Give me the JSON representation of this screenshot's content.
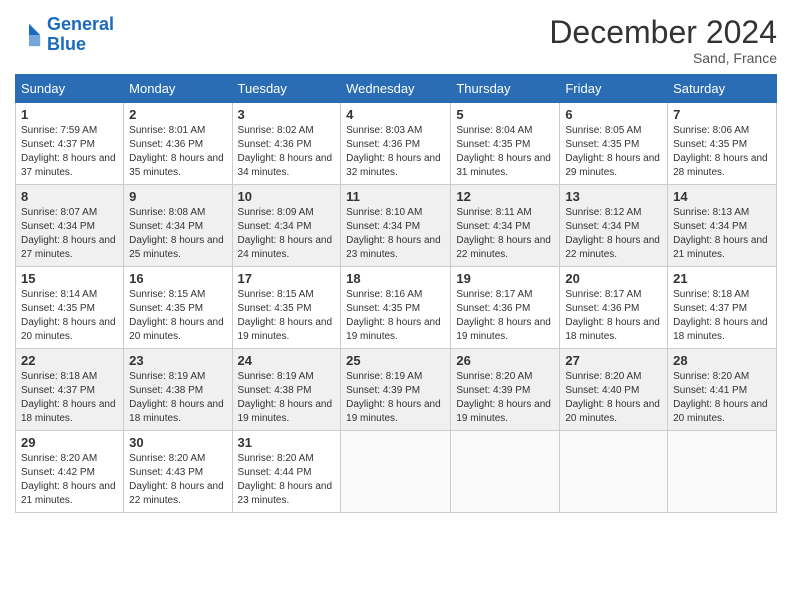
{
  "header": {
    "logo_line1": "General",
    "logo_line2": "Blue",
    "month_title": "December 2024",
    "location": "Sand, France"
  },
  "days_of_week": [
    "Sunday",
    "Monday",
    "Tuesday",
    "Wednesday",
    "Thursday",
    "Friday",
    "Saturday"
  ],
  "weeks": [
    [
      {
        "day": "1",
        "sunrise": "Sunrise: 7:59 AM",
        "sunset": "Sunset: 4:37 PM",
        "daylight": "Daylight: 8 hours and 37 minutes."
      },
      {
        "day": "2",
        "sunrise": "Sunrise: 8:01 AM",
        "sunset": "Sunset: 4:36 PM",
        "daylight": "Daylight: 8 hours and 35 minutes."
      },
      {
        "day": "3",
        "sunrise": "Sunrise: 8:02 AM",
        "sunset": "Sunset: 4:36 PM",
        "daylight": "Daylight: 8 hours and 34 minutes."
      },
      {
        "day": "4",
        "sunrise": "Sunrise: 8:03 AM",
        "sunset": "Sunset: 4:36 PM",
        "daylight": "Daylight: 8 hours and 32 minutes."
      },
      {
        "day": "5",
        "sunrise": "Sunrise: 8:04 AM",
        "sunset": "Sunset: 4:35 PM",
        "daylight": "Daylight: 8 hours and 31 minutes."
      },
      {
        "day": "6",
        "sunrise": "Sunrise: 8:05 AM",
        "sunset": "Sunset: 4:35 PM",
        "daylight": "Daylight: 8 hours and 29 minutes."
      },
      {
        "day": "7",
        "sunrise": "Sunrise: 8:06 AM",
        "sunset": "Sunset: 4:35 PM",
        "daylight": "Daylight: 8 hours and 28 minutes."
      }
    ],
    [
      {
        "day": "8",
        "sunrise": "Sunrise: 8:07 AM",
        "sunset": "Sunset: 4:34 PM",
        "daylight": "Daylight: 8 hours and 27 minutes."
      },
      {
        "day": "9",
        "sunrise": "Sunrise: 8:08 AM",
        "sunset": "Sunset: 4:34 PM",
        "daylight": "Daylight: 8 hours and 25 minutes."
      },
      {
        "day": "10",
        "sunrise": "Sunrise: 8:09 AM",
        "sunset": "Sunset: 4:34 PM",
        "daylight": "Daylight: 8 hours and 24 minutes."
      },
      {
        "day": "11",
        "sunrise": "Sunrise: 8:10 AM",
        "sunset": "Sunset: 4:34 PM",
        "daylight": "Daylight: 8 hours and 23 minutes."
      },
      {
        "day": "12",
        "sunrise": "Sunrise: 8:11 AM",
        "sunset": "Sunset: 4:34 PM",
        "daylight": "Daylight: 8 hours and 22 minutes."
      },
      {
        "day": "13",
        "sunrise": "Sunrise: 8:12 AM",
        "sunset": "Sunset: 4:34 PM",
        "daylight": "Daylight: 8 hours and 22 minutes."
      },
      {
        "day": "14",
        "sunrise": "Sunrise: 8:13 AM",
        "sunset": "Sunset: 4:34 PM",
        "daylight": "Daylight: 8 hours and 21 minutes."
      }
    ],
    [
      {
        "day": "15",
        "sunrise": "Sunrise: 8:14 AM",
        "sunset": "Sunset: 4:35 PM",
        "daylight": "Daylight: 8 hours and 20 minutes."
      },
      {
        "day": "16",
        "sunrise": "Sunrise: 8:15 AM",
        "sunset": "Sunset: 4:35 PM",
        "daylight": "Daylight: 8 hours and 20 minutes."
      },
      {
        "day": "17",
        "sunrise": "Sunrise: 8:15 AM",
        "sunset": "Sunset: 4:35 PM",
        "daylight": "Daylight: 8 hours and 19 minutes."
      },
      {
        "day": "18",
        "sunrise": "Sunrise: 8:16 AM",
        "sunset": "Sunset: 4:35 PM",
        "daylight": "Daylight: 8 hours and 19 minutes."
      },
      {
        "day": "19",
        "sunrise": "Sunrise: 8:17 AM",
        "sunset": "Sunset: 4:36 PM",
        "daylight": "Daylight: 8 hours and 19 minutes."
      },
      {
        "day": "20",
        "sunrise": "Sunrise: 8:17 AM",
        "sunset": "Sunset: 4:36 PM",
        "daylight": "Daylight: 8 hours and 18 minutes."
      },
      {
        "day": "21",
        "sunrise": "Sunrise: 8:18 AM",
        "sunset": "Sunset: 4:37 PM",
        "daylight": "Daylight: 8 hours and 18 minutes."
      }
    ],
    [
      {
        "day": "22",
        "sunrise": "Sunrise: 8:18 AM",
        "sunset": "Sunset: 4:37 PM",
        "daylight": "Daylight: 8 hours and 18 minutes."
      },
      {
        "day": "23",
        "sunrise": "Sunrise: 8:19 AM",
        "sunset": "Sunset: 4:38 PM",
        "daylight": "Daylight: 8 hours and 18 minutes."
      },
      {
        "day": "24",
        "sunrise": "Sunrise: 8:19 AM",
        "sunset": "Sunset: 4:38 PM",
        "daylight": "Daylight: 8 hours and 19 minutes."
      },
      {
        "day": "25",
        "sunrise": "Sunrise: 8:19 AM",
        "sunset": "Sunset: 4:39 PM",
        "daylight": "Daylight: 8 hours and 19 minutes."
      },
      {
        "day": "26",
        "sunrise": "Sunrise: 8:20 AM",
        "sunset": "Sunset: 4:39 PM",
        "daylight": "Daylight: 8 hours and 19 minutes."
      },
      {
        "day": "27",
        "sunrise": "Sunrise: 8:20 AM",
        "sunset": "Sunset: 4:40 PM",
        "daylight": "Daylight: 8 hours and 20 minutes."
      },
      {
        "day": "28",
        "sunrise": "Sunrise: 8:20 AM",
        "sunset": "Sunset: 4:41 PM",
        "daylight": "Daylight: 8 hours and 20 minutes."
      }
    ],
    [
      {
        "day": "29",
        "sunrise": "Sunrise: 8:20 AM",
        "sunset": "Sunset: 4:42 PM",
        "daylight": "Daylight: 8 hours and 21 minutes."
      },
      {
        "day": "30",
        "sunrise": "Sunrise: 8:20 AM",
        "sunset": "Sunset: 4:43 PM",
        "daylight": "Daylight: 8 hours and 22 minutes."
      },
      {
        "day": "31",
        "sunrise": "Sunrise: 8:20 AM",
        "sunset": "Sunset: 4:44 PM",
        "daylight": "Daylight: 8 hours and 23 minutes."
      },
      null,
      null,
      null,
      null
    ]
  ]
}
